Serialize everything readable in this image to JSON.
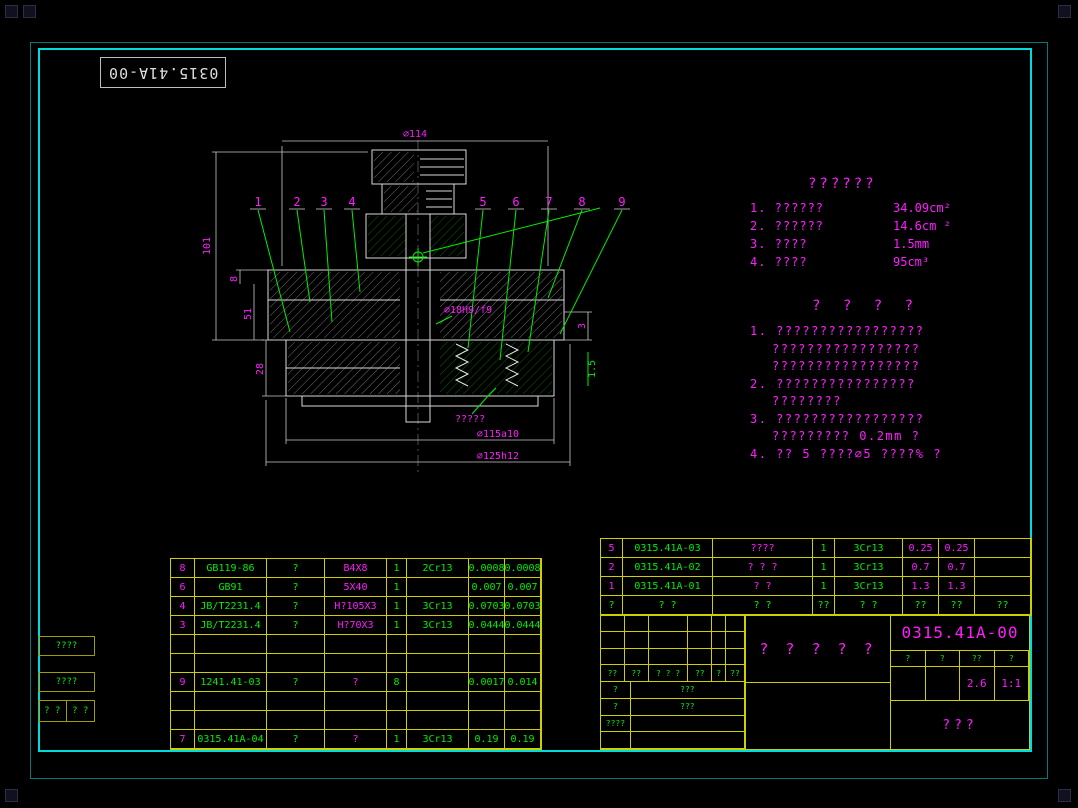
{
  "colors": {
    "frame_cyan": "#00dcdc",
    "magenta": "#ff1cff",
    "green": "#00ee00",
    "yellow": "#cfcf00"
  },
  "sheet": {
    "code_top": "0315.41A-00"
  },
  "drawing": {
    "callouts": [
      "1",
      "2",
      "3",
      "4",
      "5",
      "6",
      "7",
      "8",
      "9"
    ],
    "dims": {
      "d114": "⌀114",
      "h101": "101",
      "h8": "8",
      "h51": "51",
      "h28": "28",
      "r3": "3",
      "r15": "1.5",
      "bore": "⌀18H9/f9",
      "note": "?????",
      "d115": "⌀115a10",
      "d125": "⌀125h12"
    }
  },
  "notes": {
    "perf_title": "??????",
    "perf": [
      {
        "label": "1.  ??????",
        "value": "34.09cm²"
      },
      {
        "label": "2.  ??????",
        "value": "14.6cm ²"
      },
      {
        "label": "3.  ????",
        "value": "1.5mm"
      },
      {
        "label": "4.  ????",
        "value": "95cm³"
      }
    ],
    "tech_title": "?  ?  ?  ?",
    "tech": [
      "1.  ?????????????????",
      "?????????????????",
      "?????????????????",
      "2.  ????????????????",
      "????????",
      "3.  ?????????????????",
      "?????????   0.2mm   ?",
      "4.  ?? 5 ????⌀5   ????%   ?"
    ]
  },
  "bom_left": {
    "rows": [
      {
        "seq": "8",
        "code": "GB119-86",
        "name": "?",
        "spec": "B4X8",
        "qty": "1",
        "mat": "2Cr13",
        "w1": "0.0008",
        "w2": "0.0008"
      },
      {
        "seq": "6",
        "code": "GB91",
        "name": "?",
        "spec": "5X40",
        "qty": "1",
        "mat": "",
        "w1": "0.007",
        "w2": "0.007"
      },
      {
        "seq": "4",
        "code": "JB/T2231.4",
        "name": "?",
        "spec": "H?105X3",
        "qty": "1",
        "mat": "3Cr13",
        "w1": "0.0703",
        "w2": "0.0703"
      },
      {
        "seq": "3",
        "code": "JB/T2231.4",
        "name": "?",
        "spec": "H?70X3",
        "qty": "1",
        "mat": "3Cr13",
        "w1": "0.0444",
        "w2": "0.0444"
      },
      {
        "seq": "",
        "code": "",
        "name": "",
        "spec": "",
        "qty": "",
        "mat": "",
        "w1": "",
        "w2": ""
      },
      {
        "seq": "",
        "code": "",
        "name": "",
        "spec": "",
        "qty": "",
        "mat": "",
        "w1": "",
        "w2": ""
      },
      {
        "seq": "9",
        "code": "1241.41-03",
        "name": "?",
        "spec": "?",
        "qty": "8",
        "mat": "",
        "w1": "0.0017",
        "w2": "0.014"
      },
      {
        "seq": "",
        "code": "",
        "name": "",
        "spec": "",
        "qty": "",
        "mat": "",
        "w1": "",
        "w2": ""
      },
      {
        "seq": "",
        "code": "",
        "name": "",
        "spec": "",
        "qty": "",
        "mat": "",
        "w1": "",
        "w2": ""
      },
      {
        "seq": "7",
        "code": "0315.41A-04",
        "name": "?",
        "spec": "?",
        "qty": "1",
        "mat": "3Cr13",
        "w1": "0.19",
        "w2": "0.19"
      }
    ]
  },
  "bom_right": {
    "rows": [
      {
        "seq": "5",
        "code": "0315.41A-03",
        "name": "????",
        "qty": "1",
        "mat": "3Cr13",
        "w1": "0.25",
        "w2": "0.25",
        "note": ""
      },
      {
        "seq": "2",
        "code": "0315.41A-02",
        "name": "?   ?   ?",
        "qty": "1",
        "mat": "3Cr13",
        "w1": "0.7",
        "w2": "0.7",
        "note": ""
      },
      {
        "seq": "1",
        "code": "0315.41A-01",
        "name": "?   ?",
        "qty": "1",
        "mat": "3Cr13",
        "w1": "1.3",
        "w2": "1.3",
        "note": ""
      }
    ],
    "header": {
      "seq": "?",
      "code": "?    ?",
      "name": "?    ?",
      "qty": "??",
      "mat": "?    ?",
      "w1": "??",
      "w2": "??",
      "note": "??"
    }
  },
  "titleblock": {
    "sign_head": [
      "??",
      "??",
      "? ? ?",
      "??",
      "?",
      "??"
    ],
    "sign_rows": [
      [
        "?",
        "???"
      ],
      [
        "?",
        "???"
      ],
      [
        "????",
        ""
      ]
    ],
    "product_name": "?  ?  ?  ?  ?",
    "drawing_code": "0315.41A-00",
    "mini_headers": [
      "?",
      "?",
      "??",
      "?"
    ],
    "mini_values": [
      "",
      "",
      "2.6",
      "1:1"
    ],
    "sheet_note": "???"
  },
  "margin_boxes": {
    "box1": "????",
    "box2": "????",
    "box3a": "? ?",
    "box3b": "? ?"
  }
}
